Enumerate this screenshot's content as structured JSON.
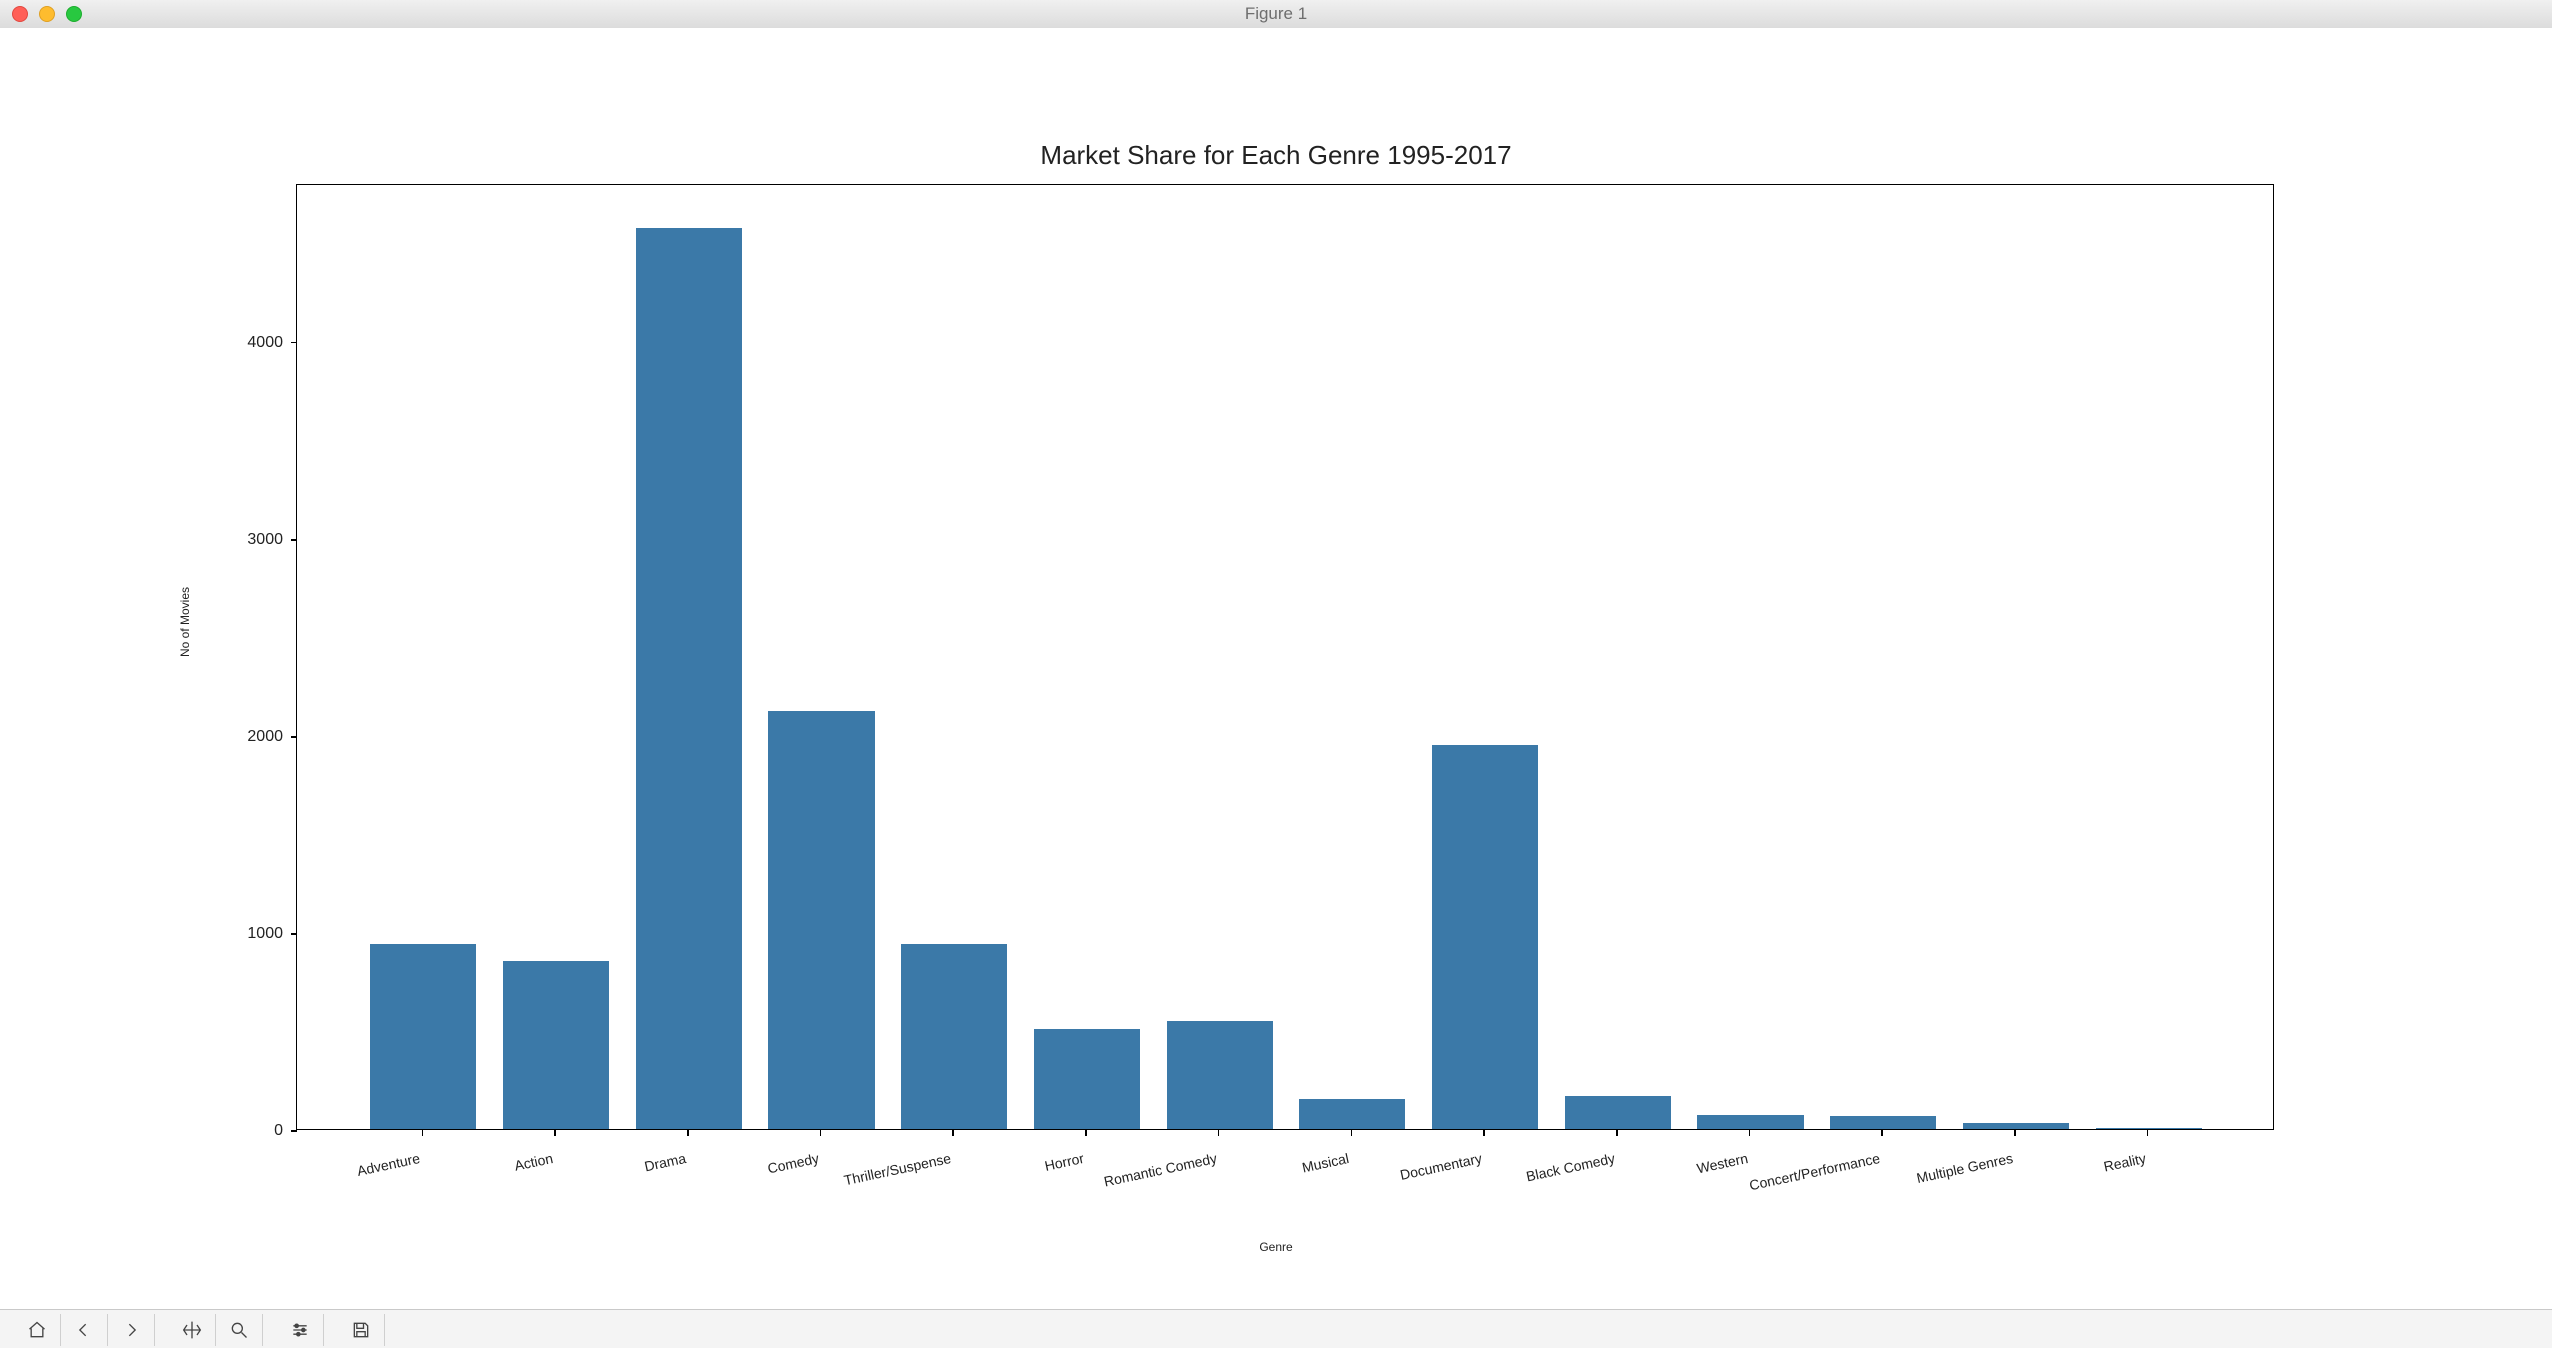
{
  "window": {
    "title": "Figure 1"
  },
  "chart_data": {
    "type": "bar",
    "title": "Market Share for Each Genre 1995-2017",
    "xlabel": "Genre",
    "ylabel": "No of Movies",
    "ylim": [
      0,
      4800
    ],
    "yticks": [
      0,
      1000,
      2000,
      3000,
      4000
    ],
    "categories": [
      "Adventure",
      "Action",
      "Drama",
      "Comedy",
      "Thriller/Suspense",
      "Horror",
      "Romantic Comedy",
      "Musical",
      "Documentary",
      "Black Comedy",
      "Western",
      "Concert/Performance",
      "Multiple Genres",
      "Reality"
    ],
    "values": [
      940,
      850,
      4570,
      2120,
      940,
      510,
      550,
      150,
      1950,
      170,
      70,
      65,
      30,
      5
    ],
    "bar_color": "#3b79a8"
  },
  "toolbar": {
    "items": [
      {
        "name": "home-icon"
      },
      {
        "name": "back-icon"
      },
      {
        "name": "forward-icon"
      },
      {
        "name": "pan-icon"
      },
      {
        "name": "zoom-icon"
      },
      {
        "name": "configure-icon"
      },
      {
        "name": "save-icon"
      }
    ]
  }
}
